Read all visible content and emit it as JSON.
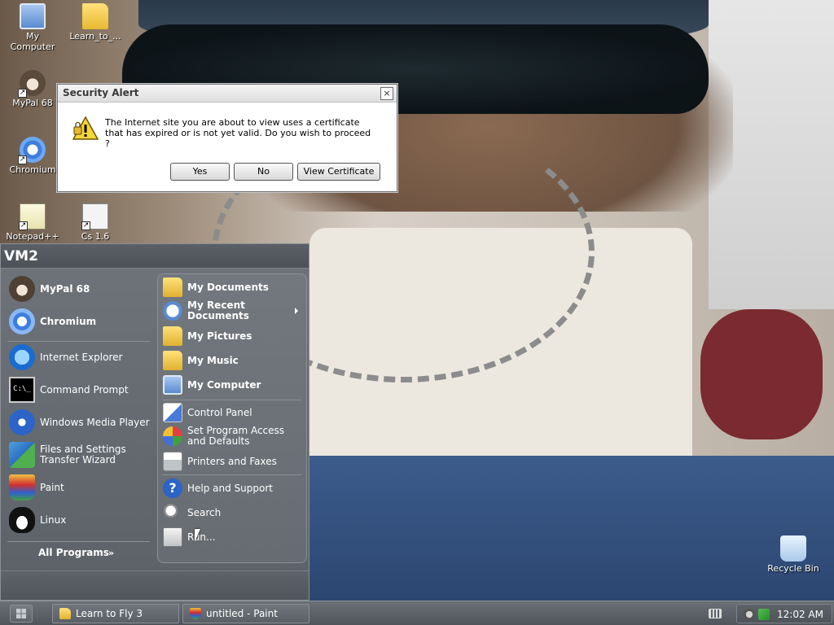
{
  "desktop": {
    "icons": [
      {
        "label": "My\nComputer",
        "icon": "my-computer-icon"
      },
      {
        "label": "Learn_to_...",
        "icon": "folder-icon"
      },
      {
        "label": "MyPal 68",
        "icon": "mypal-icon"
      },
      {
        "label": "Chromium",
        "icon": "chromium-icon"
      },
      {
        "label": "Notepad++",
        "icon": "notepad-plus-plus-icon"
      },
      {
        "label": "Cs 1.6",
        "icon": "counter-strike-icon"
      },
      {
        "label": "Recycle Bin",
        "icon": "recycle-bin-icon"
      }
    ]
  },
  "dialog": {
    "title": "Security Alert",
    "close_label": "×",
    "message": "The Internet site you are about to view uses a certificate that has expired or is not yet valid. Do you wish to proceed ?",
    "yes_label": "Yes",
    "no_label": "No",
    "view_cert_label": "View Certificate"
  },
  "start_menu": {
    "user": "VM2",
    "left_items": [
      {
        "label": "MyPal 68",
        "icon": "mypal-icon",
        "bold": true
      },
      {
        "label": "Chromium",
        "icon": "chromium-icon",
        "bold": true
      },
      {
        "label": "Internet Explorer",
        "icon": "internet-explorer-icon"
      },
      {
        "label": "Command Prompt",
        "icon": "command-prompt-icon",
        "glyph": "C:\\_"
      },
      {
        "label": "Windows Media Player",
        "icon": "media-player-icon"
      },
      {
        "label": "Files and Settings Transfer Wizard",
        "icon": "transfer-wizard-icon"
      },
      {
        "label": "Paint",
        "icon": "paint-icon"
      },
      {
        "label": "Linux",
        "icon": "linux-icon"
      }
    ],
    "all_programs_label": "All Programs",
    "all_programs_arrow": "»",
    "right_items": [
      {
        "label": "My Documents",
        "icon": "my-documents-icon",
        "bold": true
      },
      {
        "label": "My Recent Documents",
        "icon": "recent-documents-icon",
        "bold": true,
        "submenu": true
      },
      {
        "label": "My Pictures",
        "icon": "my-pictures-icon",
        "bold": true
      },
      {
        "label": "My Music",
        "icon": "my-music-icon",
        "bold": true
      },
      {
        "label": "My Computer",
        "icon": "my-computer-icon",
        "bold": true
      },
      {
        "label": "Control Panel",
        "icon": "control-panel-icon"
      },
      {
        "label": "Set Program Access and Defaults",
        "icon": "program-access-icon"
      },
      {
        "label": "Printers and Faxes",
        "icon": "printer-icon"
      },
      {
        "label": "Help and Support",
        "icon": "help-icon",
        "glyph": "?"
      },
      {
        "label": "Search",
        "icon": "search-icon"
      },
      {
        "label": "Run...",
        "icon": "run-icon"
      }
    ]
  },
  "taskbar": {
    "buttons": [
      {
        "label": "Learn to Fly 3",
        "icon": "folder-icon"
      },
      {
        "label": "untitled - Paint",
        "icon": "paint-icon"
      }
    ],
    "clock": "12:02 AM"
  }
}
